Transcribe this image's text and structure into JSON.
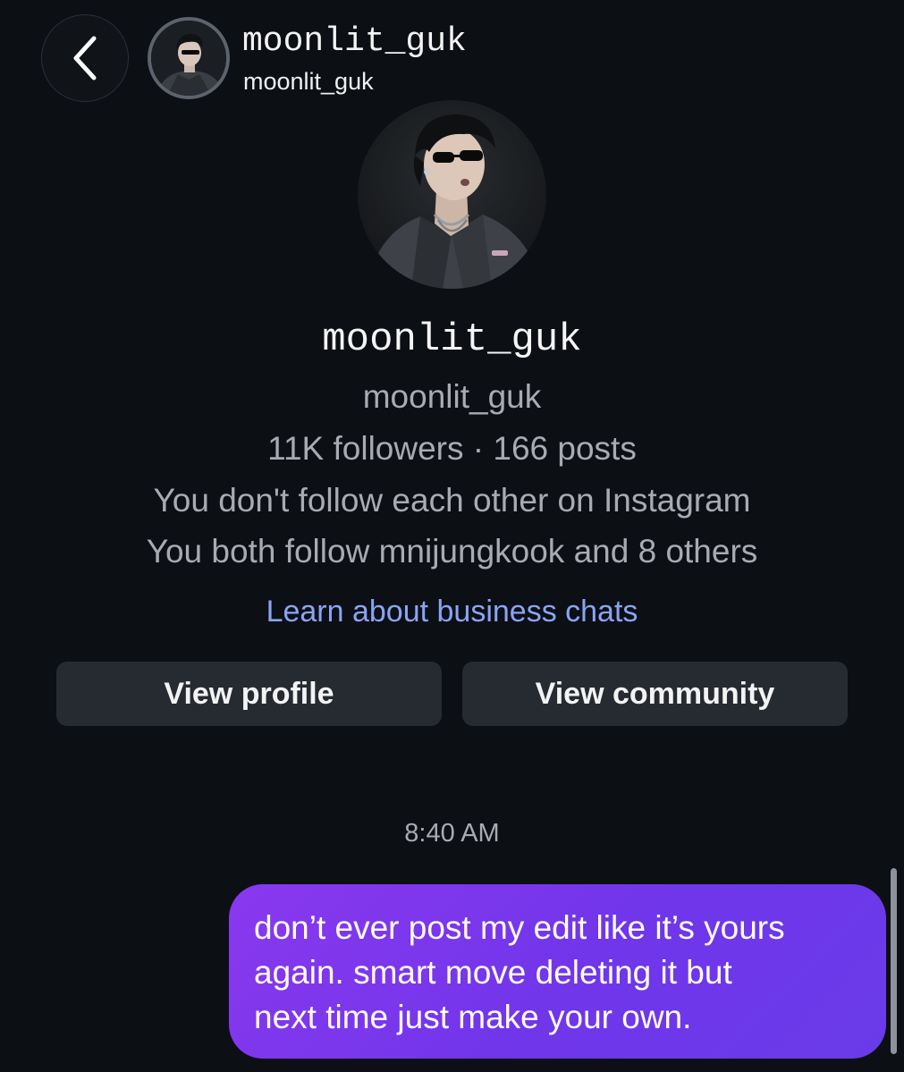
{
  "header": {
    "back_icon": "chevron-left-icon",
    "display_name": "moonlit_guk",
    "username": "moonlit_guk"
  },
  "profile": {
    "display_name": "moonlit_guk",
    "username": "moonlit_guk",
    "stats": "11K followers · 166 posts",
    "follow_status": "You don't follow each other on Instagram",
    "mutual_follows": "You both follow mnijungkook and 8 others",
    "learn_link": "Learn about business chats"
  },
  "actions": {
    "view_profile_label": "View profile",
    "view_community_label": "View community"
  },
  "thread": {
    "timestamp": "8:40 AM",
    "messages": [
      {
        "sender": "me",
        "lines": [
          "don’t ever post my edit like it’s yours",
          "again. smart move deleting it but",
          "next time just make your own."
        ]
      }
    ]
  },
  "colors": {
    "background": "#0c0f14",
    "link": "#8aa4f5",
    "button_bg": "#262a31",
    "bubble_start": "#8a38ee",
    "bubble_end": "#6a3be9",
    "secondary_text": "#a8abb2"
  }
}
